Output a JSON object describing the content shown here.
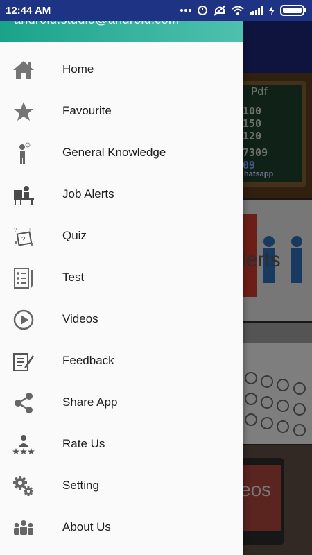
{
  "status_bar": {
    "time": "12:44 AM",
    "icons": [
      "more-dots-icon",
      "data-saver-icon",
      "mute-icon",
      "wifi-icon",
      "signal-icon",
      "charging-icon",
      "battery-icon"
    ]
  },
  "drawer": {
    "email": "android.studio@android.com",
    "accent_color": "#1aa38a",
    "items": [
      {
        "label": "Home",
        "icon": "home-icon"
      },
      {
        "label": "Favourite",
        "icon": "star-icon"
      },
      {
        "label": "General Knowledge",
        "icon": "thinking-person-icon"
      },
      {
        "label": "Job Alerts",
        "icon": "desk-worker-icon"
      },
      {
        "label": "Quiz",
        "icon": "quiz-icon"
      },
      {
        "label": "Test",
        "icon": "test-sheet-icon"
      },
      {
        "label": "Videos",
        "icon": "play-circle-icon"
      },
      {
        "label": "Feedback",
        "icon": "feedback-icon"
      },
      {
        "label": "Share App",
        "icon": "share-icon"
      },
      {
        "label": "Rate Us",
        "icon": "rate-icon"
      },
      {
        "label": "Setting",
        "icon": "gears-icon"
      },
      {
        "label": "About Us",
        "icon": "group-icon"
      }
    ]
  },
  "background": {
    "card1_lines": [
      "Pdf",
      "100",
      "150",
      "120",
      "7309",
      "09"
    ],
    "card1_footer": "hatsapp",
    "card2_text": "lerts",
    "card4_text": "eos"
  }
}
